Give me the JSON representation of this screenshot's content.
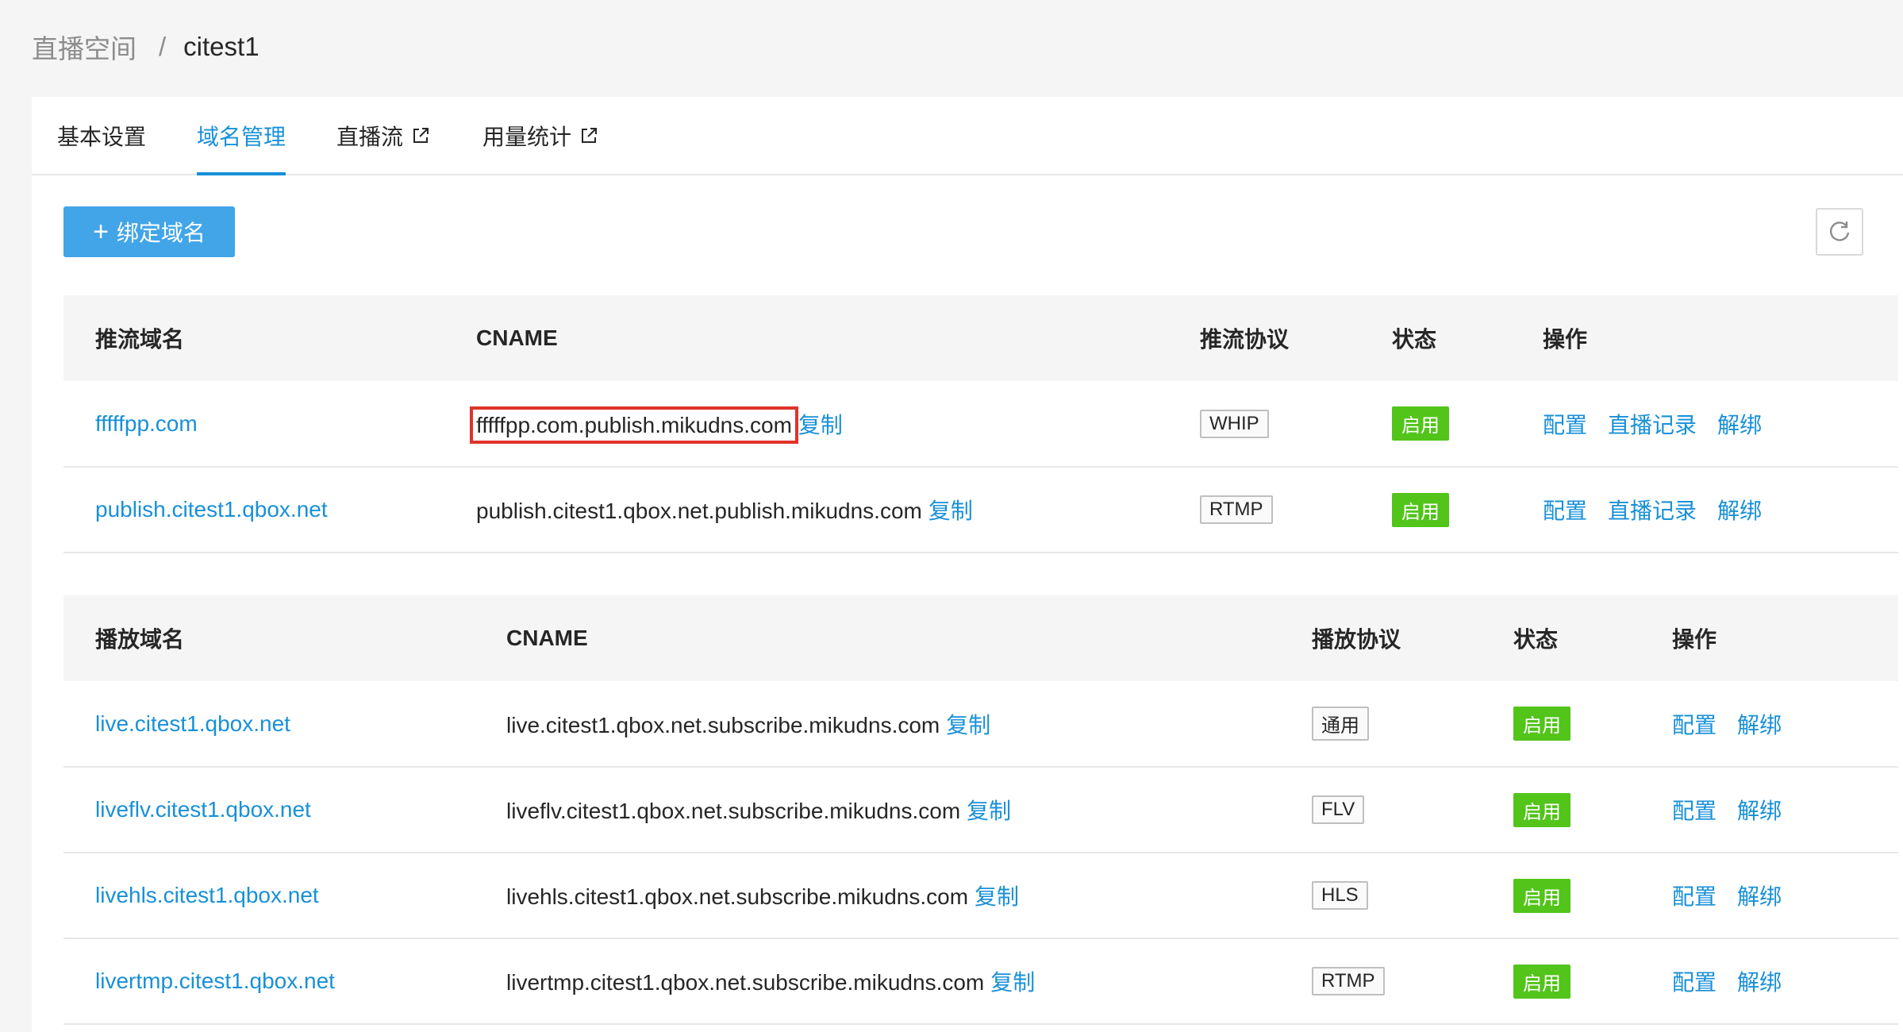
{
  "breadcrumb": {
    "parent": "直播空间",
    "separator": "/",
    "current": "citest1"
  },
  "tabs": [
    {
      "label": "基本设置"
    },
    {
      "label": "域名管理"
    },
    {
      "label": "直播流"
    },
    {
      "label": "用量统计"
    }
  ],
  "toolbar": {
    "bind_label": "绑定域名",
    "plus": "+"
  },
  "publish_table": {
    "headers": [
      "推流域名",
      "CNAME",
      "推流协议",
      "状态",
      "操作"
    ],
    "rows": [
      {
        "domain": "fffffpp.com",
        "cname": "fffffpp.com.publish.mikudns.com",
        "protocol": "WHIP",
        "status": "启用"
      },
      {
        "domain": "publish.citest1.qbox.net",
        "cname": "publish.citest1.qbox.net.publish.mikudns.com",
        "protocol": "RTMP",
        "status": "启用"
      }
    ]
  },
  "play_table": {
    "headers": [
      "播放域名",
      "CNAME",
      "播放协议",
      "状态",
      "操作"
    ],
    "rows": [
      {
        "domain": "live.citest1.qbox.net",
        "cname": "live.citest1.qbox.net.subscribe.mikudns.com",
        "protocol": "通用",
        "status": "启用"
      },
      {
        "domain": "liveflv.citest1.qbox.net",
        "cname": "liveflv.citest1.qbox.net.subscribe.mikudns.com",
        "protocol": "FLV",
        "status": "启用"
      },
      {
        "domain": "livehls.citest1.qbox.net",
        "cname": "livehls.citest1.qbox.net.subscribe.mikudns.com",
        "protocol": "HLS",
        "status": "启用"
      },
      {
        "domain": "livertmp.citest1.qbox.net",
        "cname": "livertmp.citest1.qbox.net.subscribe.mikudns.com",
        "protocol": "RTMP",
        "status": "启用"
      }
    ]
  },
  "actions": {
    "copy": "复制",
    "configure": "配置",
    "records": "直播记录",
    "unbind": "解绑"
  },
  "colors": {
    "accent": "#1890d8",
    "button": "#42a5e8",
    "status_on": "#52c41a",
    "highlight": "#e0332a"
  }
}
